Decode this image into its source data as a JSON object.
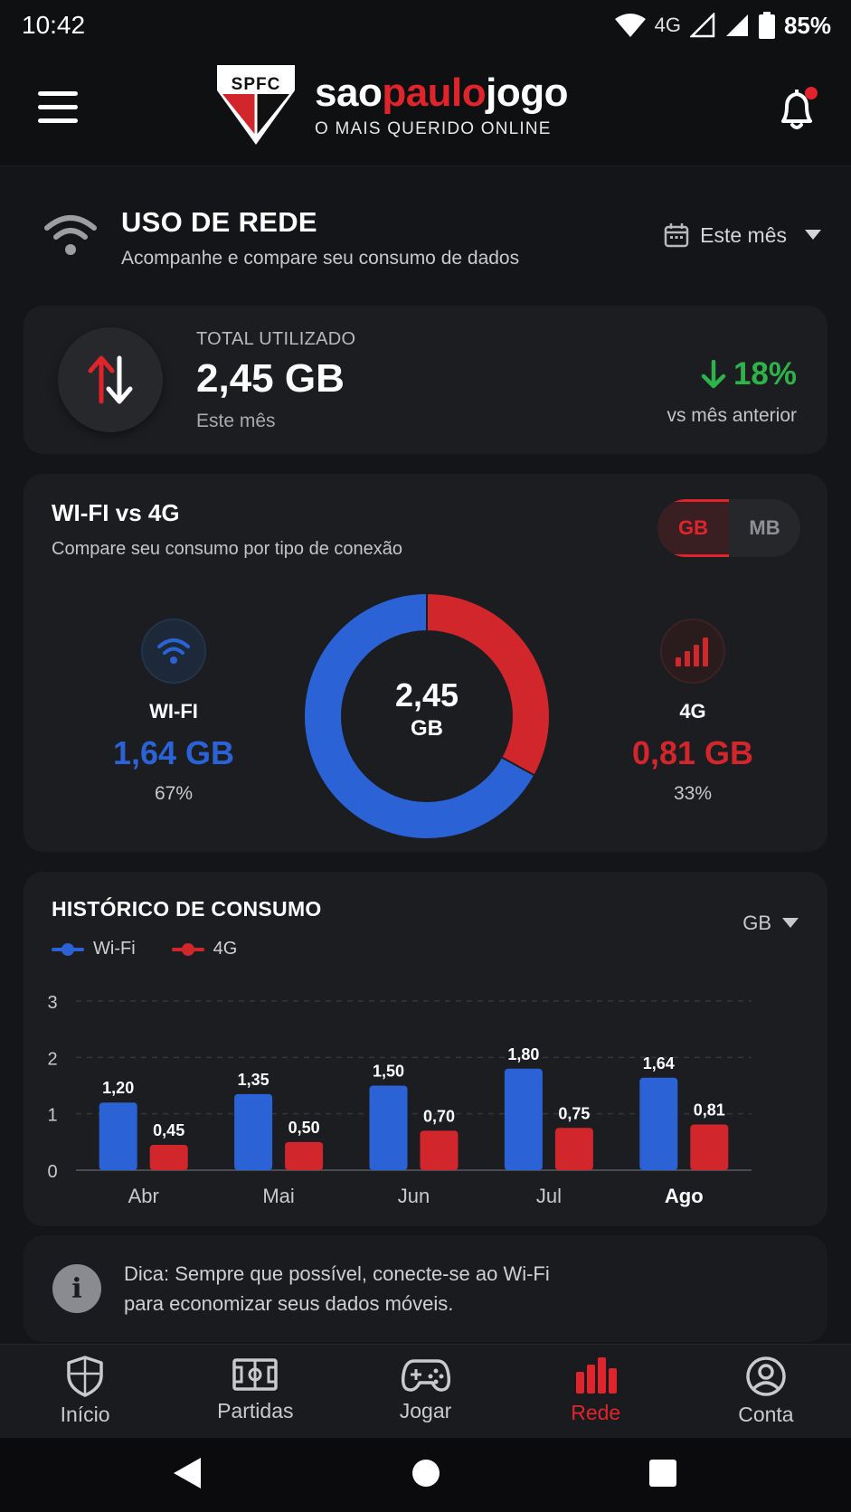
{
  "status": {
    "time": "10:42",
    "network": "4G",
    "battery": "85%"
  },
  "header": {
    "logo_text": "SPFC",
    "brand": {
      "part1": "sao",
      "part2": "paulo",
      "part3": "jogo"
    },
    "tagline": "O MAIS QUERIDO ONLINE",
    "menu_icon": "menu-icon",
    "notification_icon": "bell-icon"
  },
  "section": {
    "title": "USO DE REDE",
    "subtitle": "Acompanhe e compare seu consumo de dados",
    "period": "Este mês"
  },
  "total": {
    "label": "TOTAL UTILIZADO",
    "value": "2,45 GB",
    "period": "Este mês",
    "change": "18%",
    "change_direction": "down",
    "change_label": "vs mês anterior"
  },
  "compare": {
    "title": "WI-FI vs 4G",
    "subtitle": "Compare seu consumo por tipo de conexão",
    "units": [
      "GB",
      "MB"
    ],
    "selected_unit": "GB",
    "wifi": {
      "name": "WI-FI",
      "value": "1,64 GB",
      "percent": "67%",
      "fraction": 0.67,
      "color": "#2b63d6"
    },
    "mobile": {
      "name": "4G",
      "value": "0,81 GB",
      "percent": "33%",
      "fraction": 0.33,
      "color": "#d2262d"
    },
    "total_value": "2,45",
    "total_unit": "GB"
  },
  "history": {
    "title": "HISTÓRICO DE CONSUMO",
    "unit": "GB",
    "legend": [
      "Wi-Fi",
      "4G"
    ]
  },
  "chart_data": {
    "type": "bar",
    "categories": [
      "Abr",
      "Mai",
      "Jun",
      "Jul",
      "Ago"
    ],
    "series": [
      {
        "name": "Wi-Fi",
        "color": "#2b63d6",
        "values": [
          1.2,
          1.35,
          1.5,
          1.8,
          1.64
        ],
        "labels": [
          "1,20",
          "1,35",
          "1,50",
          "1,80",
          "1,64"
        ]
      },
      {
        "name": "4G",
        "color": "#d2262d",
        "values": [
          0.45,
          0.5,
          0.7,
          0.75,
          0.81
        ],
        "labels": [
          "0,45",
          "0,50",
          "0,70",
          "0,75",
          "0,81"
        ]
      }
    ],
    "yticks": [
      "0",
      "1",
      "2",
      "3"
    ],
    "ylim": [
      0,
      3
    ],
    "grid": true,
    "highlight_category": "Ago",
    "legend_position": "top-left"
  },
  "tip": {
    "text_line1": "Dica: Sempre que possível, conecte-se ao Wi-Fi",
    "text_line2": "para economizar seus dados móveis."
  },
  "nav": {
    "items": [
      {
        "label": "Início",
        "icon": "shield-icon"
      },
      {
        "label": "Partidas",
        "icon": "field-icon"
      },
      {
        "label": "Jogar",
        "icon": "gamepad-icon"
      },
      {
        "label": "Rede",
        "icon": "bar-chart-icon"
      },
      {
        "label": "Conta",
        "icon": "user-icon"
      }
    ],
    "active": "Rede"
  }
}
